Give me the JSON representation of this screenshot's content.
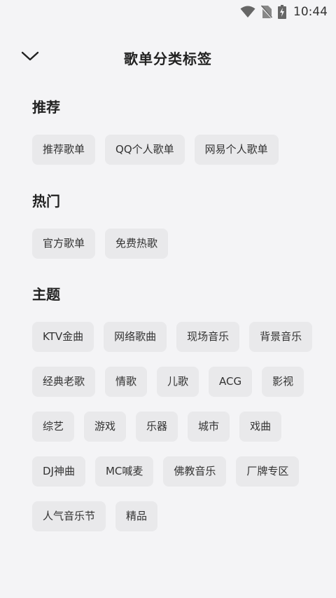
{
  "status_bar": {
    "time": "10:44"
  },
  "header": {
    "title": "歌单分类标签",
    "back_icon": "chevron-down-icon"
  },
  "sections": [
    {
      "title": "推荐",
      "tags": [
        "推荐歌单",
        "QQ个人歌单",
        "网易个人歌单"
      ]
    },
    {
      "title": "热门",
      "tags": [
        "官方歌单",
        "免费热歌"
      ]
    },
    {
      "title": "主题",
      "tags": [
        "KTV金曲",
        "网络歌曲",
        "现场音乐",
        "背景音乐",
        "经典老歌",
        "情歌",
        "儿歌",
        "ACG",
        "影视",
        "综艺",
        "游戏",
        "乐器",
        "城市",
        "戏曲",
        "DJ神曲",
        "MC喊麦",
        "佛教音乐",
        "厂牌专区",
        "人气音乐节",
        "精品"
      ]
    }
  ]
}
